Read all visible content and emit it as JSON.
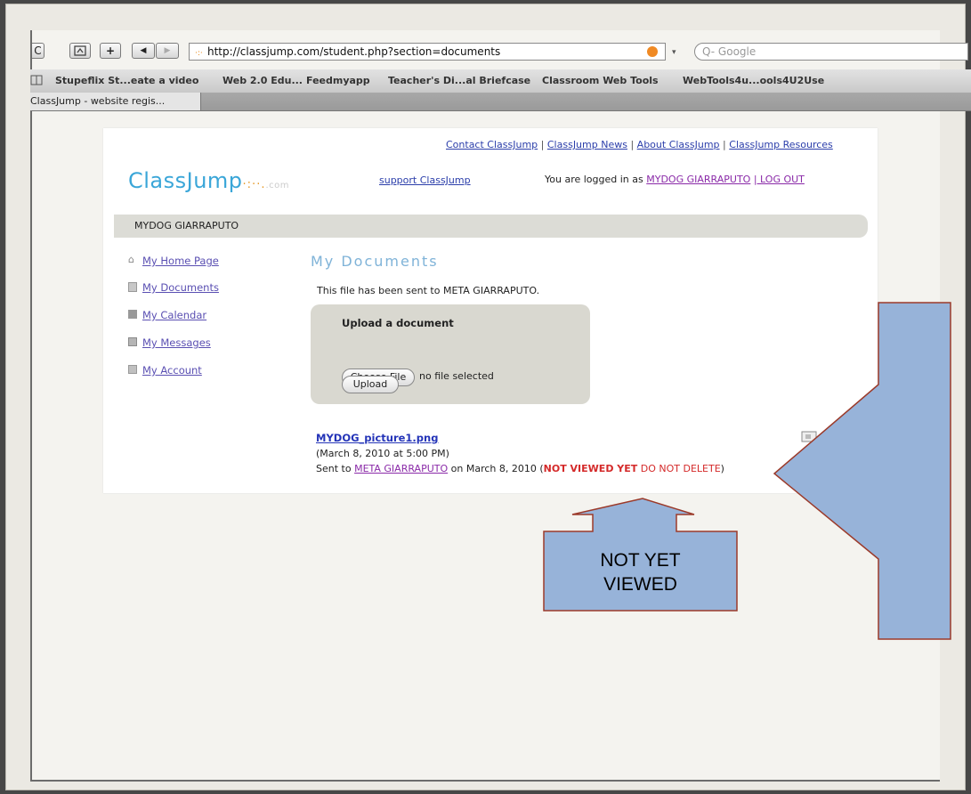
{
  "browser": {
    "url": "http://classjump.com/student.php?section=documents",
    "search_placeholder": "Q- Google",
    "reload_glyph": "C",
    "add_glyph": "+",
    "back_glyph": "◀",
    "forward_glyph": "▶",
    "bookmarks": [
      "Stupeflix St...eate a video",
      "Web 2.0 Edu...",
      "Feedmyapp",
      "Teacher's Di...al Briefcase",
      "Classroom Web Tools",
      "WebTools4u...ools4U2Use"
    ],
    "tab_label": "ClassJump - website regis..."
  },
  "site": {
    "logo_text": "ClassJump",
    "logo_suffix": ".com",
    "top_links": [
      "Contact ClassJump",
      "ClassJump News",
      "About ClassJump",
      "ClassJump Resources"
    ],
    "separator": "|",
    "support_link": "support ClassJump",
    "logged_in_prefix": "You are logged in as",
    "logged_in_user": "MYDOG GIARRAPUTO",
    "logout_link": "| LOG OUT",
    "user_bar": "MYDOG GIARRAPUTO"
  },
  "sidebar": {
    "items": [
      {
        "label": "My Home Page",
        "icon": "home-icon"
      },
      {
        "label": "My Documents",
        "icon": "document-icon"
      },
      {
        "label": "My Calendar",
        "icon": "calendar-icon"
      },
      {
        "label": "My Messages",
        "icon": "messages-icon"
      },
      {
        "label": "My Account",
        "icon": "account-icon"
      }
    ]
  },
  "main": {
    "heading": "My Documents",
    "status_message": "This file has been sent to META GIARRAPUTO.",
    "upload": {
      "title": "Upload a document",
      "choose_button": "Choose File",
      "no_file_text": "no file selected",
      "upload_button": "Upload"
    },
    "file": {
      "name": "MYDOG_picture1.png",
      "date": "(March 8, 2010 at 5:00 PM)",
      "sent_prefix": "Sent to",
      "recipient": "META GIARRAPUTO",
      "sent_date": "on March 8, 2010 (",
      "status_bold": "NOT VIEWED YET",
      "status_note": "DO NOT DELETE",
      "close_paren": ")"
    }
  },
  "callout": {
    "text_line1": "NOT YET",
    "text_line2": "VIEWED"
  },
  "colors": {
    "arrow_fill": "#97b3d9",
    "arrow_stroke": "#9b3a2a",
    "status_red": "#d42a2a",
    "logo_blue": "#3aa6d8"
  }
}
